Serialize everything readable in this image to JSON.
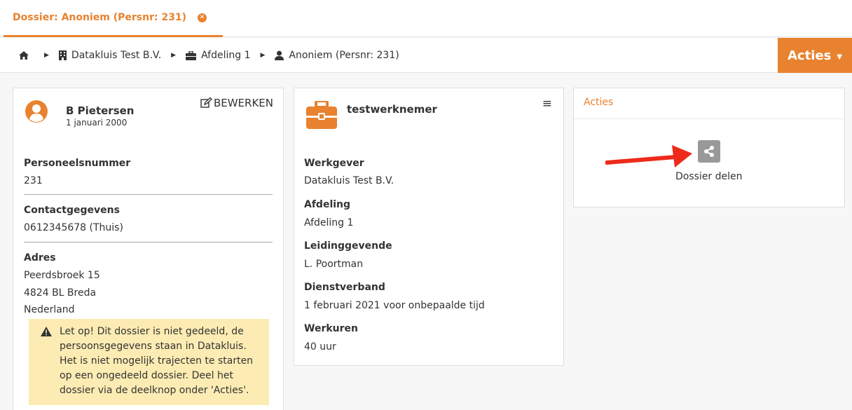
{
  "tab": {
    "title": "Dossier: Anoniem (Persnr: 231)",
    "close_glyph": "✕"
  },
  "breadcrumb": {
    "home_icon": "home-icon",
    "items": [
      {
        "label": "Datakluis Test B.V.",
        "icon": "building-icon"
      },
      {
        "label": "Afdeling 1",
        "icon": "briefcase-icon"
      },
      {
        "label": "Anoniem (Persnr: 231)",
        "icon": "user-icon"
      }
    ]
  },
  "actions_button": {
    "label": "Acties",
    "caret": "▼"
  },
  "person": {
    "name": "B Pietersen",
    "birthdate": "1 januari 2000",
    "edit_label": "BEWERKEN",
    "fields": [
      {
        "label": "Personeelsnummer",
        "value": "231"
      },
      {
        "label": "Contactgegevens",
        "value": "0612345678 (Thuis)"
      }
    ],
    "address": {
      "label": "Adres",
      "line1": "Peerdsbroek 15",
      "line2": "4824 BL Breda",
      "line3": "Nederland"
    },
    "warning": "Let op! Dit dossier is niet gedeeld, de persoonsgegevens staan in Datakluis. Het is niet mogelijk trajecten te starten op een ongedeeld dossier. Deel het dossier via de deelknop onder 'Acties'."
  },
  "employment": {
    "title": "testwerknemer",
    "menu_glyph": "≡",
    "fields": [
      {
        "label": "Werkgever",
        "value": "Datakluis Test B.V."
      },
      {
        "label": "Afdeling",
        "value": "Afdeling 1"
      },
      {
        "label": "Leidinggevende",
        "value": "L. Poortman"
      },
      {
        "label": "Dienstverband",
        "value": "1 februari 2021 voor onbepaalde tijd"
      },
      {
        "label": "Werkuren",
        "value": "40 uur"
      }
    ]
  },
  "actions_panel": {
    "title": "Acties",
    "share_label": "Dossier delen"
  },
  "colors": {
    "accent": "#e8822e",
    "warning_bg": "#fcecb3",
    "annotation_arrow": "#ee2a1a"
  }
}
